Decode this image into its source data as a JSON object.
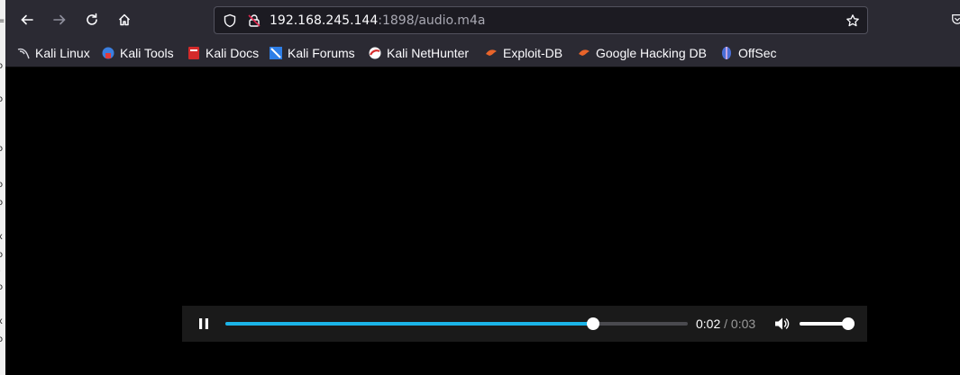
{
  "navbar": {
    "back": "back-arrow-icon",
    "forward": "forward-arrow-icon",
    "reload": "reload-icon",
    "home": "home-icon",
    "url_host": "192.168.245.144",
    "url_rest": ":1898/audio.m4a"
  },
  "bookmarks": [
    {
      "label": "Kali Linux",
      "icon": "kali-dragon-icon"
    },
    {
      "label": "Kali Tools",
      "icon": "kali-tools-icon"
    },
    {
      "label": "Kali Docs",
      "icon": "kali-docs-icon"
    },
    {
      "label": "Kali Forums",
      "icon": "kali-forums-icon"
    },
    {
      "label": "Kali NetHunter",
      "icon": "kali-nethunter-icon"
    },
    {
      "label": "Exploit-DB",
      "icon": "exploit-db-icon"
    },
    {
      "label": "Google Hacking DB",
      "icon": "ghdb-icon"
    },
    {
      "label": "OffSec",
      "icon": "offsec-icon"
    }
  ],
  "player": {
    "state": "playing",
    "progress_fraction": 0.795,
    "current_time": "0:02",
    "separator": " / ",
    "duration": "0:03",
    "volume_fraction": 1.0
  },
  "colors": {
    "toolbar": "#2b2a33",
    "accent": "#1bb4e8"
  }
}
